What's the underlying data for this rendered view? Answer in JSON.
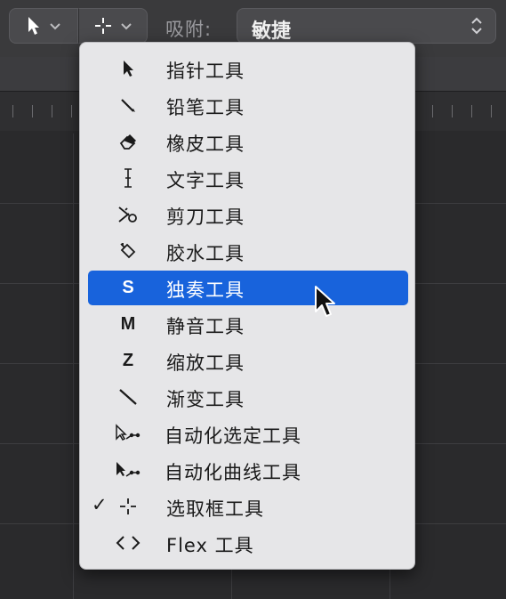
{
  "toolbar": {
    "left_tool_icon": "pointer-icon",
    "right_tool_icon": "marquee-crosshair-icon",
    "snap_label": "吸附:",
    "snap_value": "敏捷"
  },
  "menu": {
    "items": [
      {
        "label": "指针工具",
        "icon": "pointer-icon",
        "checked": false,
        "selected": false
      },
      {
        "label": "铅笔工具",
        "icon": "pencil-icon",
        "checked": false,
        "selected": false
      },
      {
        "label": "橡皮工具",
        "icon": "eraser-icon",
        "checked": false,
        "selected": false
      },
      {
        "label": "文字工具",
        "icon": "text-cursor-icon",
        "checked": false,
        "selected": false
      },
      {
        "label": "剪刀工具",
        "icon": "scissors-icon",
        "checked": false,
        "selected": false
      },
      {
        "label": "胶水工具",
        "icon": "glue-icon",
        "checked": false,
        "selected": false
      },
      {
        "label": "独奏工具",
        "icon": "S",
        "checked": false,
        "selected": true
      },
      {
        "label": "静音工具",
        "icon": "M",
        "checked": false,
        "selected": false
      },
      {
        "label": "缩放工具",
        "icon": "Z",
        "checked": false,
        "selected": false
      },
      {
        "label": "渐变工具",
        "icon": "fade-icon",
        "checked": false,
        "selected": false
      },
      {
        "label": "自动化选定工具",
        "icon": "automation-select-icon",
        "checked": false,
        "selected": false
      },
      {
        "label": "自动化曲线工具",
        "icon": "automation-curve-icon",
        "checked": false,
        "selected": false
      },
      {
        "label": "选取框工具",
        "icon": "marquee-crosshair-icon",
        "checked": true,
        "checkmark": "✓",
        "selected": false
      },
      {
        "label": "Flex 工具",
        "icon": "flex-icon",
        "checked": false,
        "selected": false
      }
    ]
  },
  "colors": {
    "menu_bg": "#e6e6e8",
    "highlight": "#1863dc",
    "toolbar_bg": "#3a3a3c"
  }
}
